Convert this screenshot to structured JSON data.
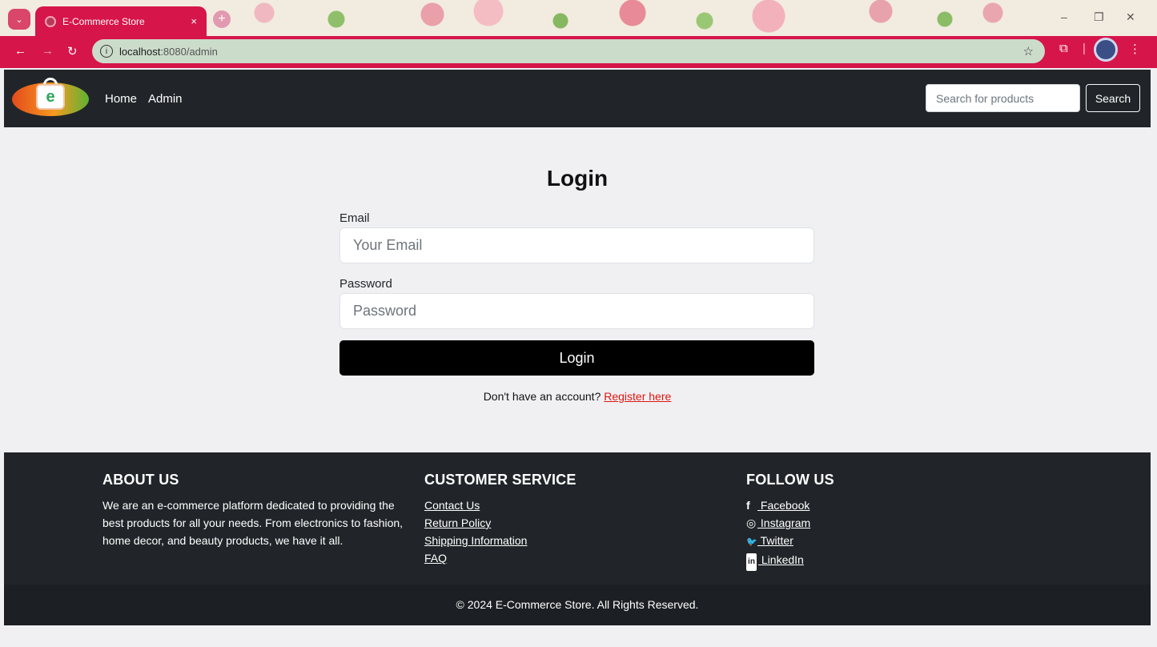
{
  "browser": {
    "tab_title": "E-Commerce Store",
    "tab_close": "×",
    "new_tab": "+",
    "url_host": "localhost",
    "url_rest": ":8080/admin",
    "minimize": "–",
    "restore": "❐",
    "close": "✕"
  },
  "navbar": {
    "logo_letter": "e",
    "links": [
      "Home",
      "Admin"
    ],
    "search_placeholder": "Search for products",
    "search_button": "Search"
  },
  "login": {
    "title": "Login",
    "email_label": "Email",
    "email_placeholder": "Your Email",
    "password_label": "Password",
    "password_placeholder": "Password",
    "submit": "Login",
    "no_account_text": "Don't have an account?",
    "register_link": "Register here"
  },
  "footer": {
    "about": {
      "heading": "ABOUT US",
      "text": "We are an e-commerce platform dedicated to providing the best products for all your needs. From electronics to fashion, home decor, and beauty products, we have it all."
    },
    "service": {
      "heading": "CUSTOMER SERVICE",
      "links": [
        "Contact Us",
        "Return Policy",
        "Shipping Information",
        "FAQ"
      ]
    },
    "follow": {
      "heading": "FOLLOW US",
      "links": [
        {
          "icon": "facebook-icon",
          "glyph": "f",
          "label": " Facebook"
        },
        {
          "icon": "instagram-icon",
          "glyph": "◎",
          "label": " Instagram"
        },
        {
          "icon": "twitter-icon",
          "glyph": "🐦",
          "label": " Twitter"
        },
        {
          "icon": "linkedin-icon",
          "glyph": "in",
          "label": " LinkedIn"
        }
      ]
    },
    "copyright": "© 2024 E-Commerce Store. All Rights Reserved."
  },
  "colors": {
    "chrome_accent": "#d6154a",
    "navbar_bg": "#212529",
    "page_bg": "#f0f0f3",
    "register_link": "#e0150f"
  }
}
